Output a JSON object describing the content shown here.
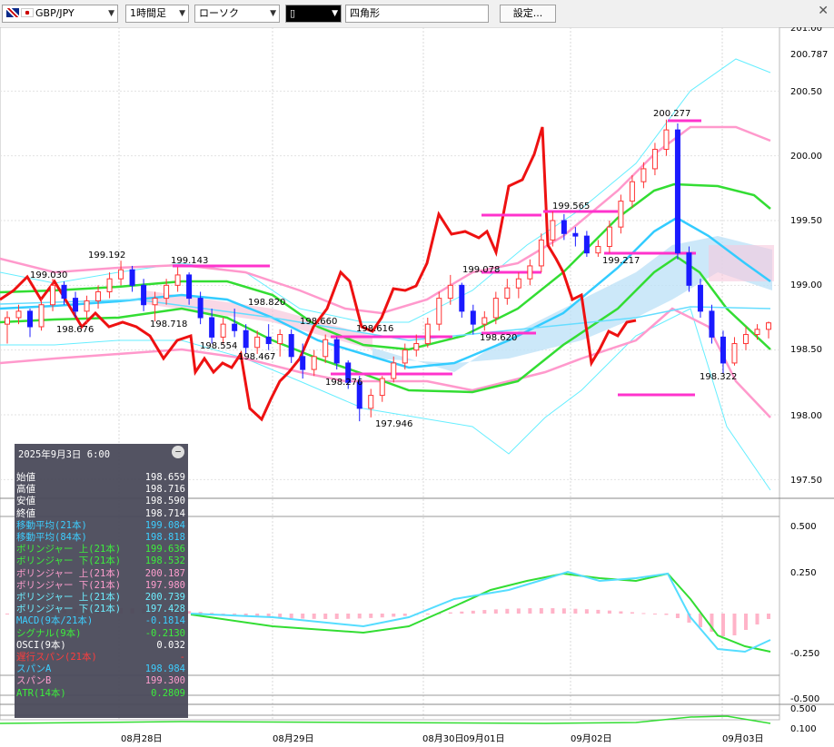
{
  "toolbar": {
    "symbol": "GBP/JPY",
    "timeframe": "1時間足",
    "chart_type": "ローソク",
    "draw_tool": "四角形",
    "settings_label": "設定...",
    "close_icon": "close-icon"
  },
  "chart_data": {
    "type": "candlestick",
    "y_axis": {
      "min": 197.9,
      "max": 201.0,
      "ticks": [
        "201.00",
        "200.787",
        "200.50",
        "200.00",
        "199.50",
        "199.00",
        "198.50",
        "198.00",
        "197.50"
      ]
    },
    "x_labels": [
      "08月28日",
      "08月29日",
      "08月30日",
      "09月01日",
      "09月02日",
      "09月03日"
    ],
    "annotations": [
      "199.192",
      "199.030",
      "199.143",
      "198.676",
      "198.718",
      "198.820",
      "198.554",
      "198.467",
      "198.660",
      "198.616",
      "198.276",
      "197.946",
      "199.078",
      "198.620",
      "199.565",
      "199.217",
      "200.277",
      "198.322"
    ],
    "candles": [
      [
        198.7,
        198.8,
        198.55,
        198.75
      ],
      [
        198.75,
        198.85,
        198.7,
        198.8
      ],
      [
        198.8,
        198.82,
        198.6,
        198.68
      ],
      [
        198.68,
        198.9,
        198.65,
        198.85
      ],
      [
        198.85,
        199.05,
        198.8,
        199.0
      ],
      [
        199.0,
        199.03,
        198.85,
        198.9
      ],
      [
        198.9,
        198.95,
        198.75,
        198.8
      ],
      [
        198.8,
        198.92,
        198.7,
        198.88
      ],
      [
        198.88,
        199.0,
        198.82,
        198.95
      ],
      [
        198.95,
        199.1,
        198.9,
        199.05
      ],
      [
        199.05,
        199.19,
        199.0,
        199.12
      ],
      [
        199.12,
        199.15,
        198.95,
        199.0
      ],
      [
        199.0,
        199.05,
        198.8,
        198.85
      ],
      [
        198.85,
        198.95,
        198.72,
        198.9
      ],
      [
        198.9,
        199.05,
        198.85,
        199.0
      ],
      [
        199.0,
        199.14,
        198.95,
        199.08
      ],
      [
        199.08,
        199.1,
        198.85,
        198.9
      ],
      [
        198.9,
        198.95,
        198.7,
        198.75
      ],
      [
        198.75,
        198.82,
        198.55,
        198.6
      ],
      [
        198.6,
        198.75,
        198.55,
        198.7
      ],
      [
        198.7,
        198.82,
        198.6,
        198.65
      ],
      [
        198.65,
        198.7,
        198.47,
        198.52
      ],
      [
        198.52,
        198.65,
        198.47,
        198.6
      ],
      [
        198.6,
        198.7,
        198.5,
        198.55
      ],
      [
        198.55,
        198.66,
        198.45,
        198.62
      ],
      [
        198.62,
        198.66,
        198.4,
        198.45
      ],
      [
        198.45,
        198.55,
        198.28,
        198.35
      ],
      [
        198.35,
        198.5,
        198.3,
        198.45
      ],
      [
        198.45,
        198.62,
        198.4,
        198.58
      ],
      [
        198.58,
        198.6,
        198.35,
        198.4
      ],
      [
        198.4,
        198.42,
        198.2,
        198.25
      ],
      [
        198.25,
        198.3,
        197.95,
        198.05
      ],
      [
        198.05,
        198.2,
        197.98,
        198.15
      ],
      [
        198.15,
        198.3,
        198.1,
        198.28
      ],
      [
        198.28,
        198.45,
        198.25,
        198.4
      ],
      [
        198.4,
        198.55,
        198.35,
        198.5
      ],
      [
        198.5,
        198.62,
        198.45,
        198.55
      ],
      [
        198.55,
        198.75,
        198.52,
        198.7
      ],
      [
        198.7,
        198.95,
        198.65,
        198.9
      ],
      [
        198.9,
        199.08,
        198.85,
        199.0
      ],
      [
        199.0,
        199.02,
        198.75,
        198.8
      ],
      [
        198.8,
        198.85,
        198.62,
        198.7
      ],
      [
        198.7,
        198.8,
        198.65,
        198.75
      ],
      [
        198.75,
        198.95,
        198.7,
        198.9
      ],
      [
        198.9,
        199.05,
        198.85,
        198.98
      ],
      [
        198.98,
        199.1,
        198.9,
        199.05
      ],
      [
        199.05,
        199.2,
        199.0,
        199.15
      ],
      [
        199.15,
        199.4,
        199.1,
        199.35
      ],
      [
        199.35,
        199.57,
        199.3,
        199.5
      ],
      [
        199.5,
        199.55,
        199.35,
        199.4
      ],
      [
        199.4,
        199.45,
        199.3,
        199.38
      ],
      [
        199.38,
        199.42,
        199.22,
        199.25
      ],
      [
        199.25,
        199.35,
        199.22,
        199.3
      ],
      [
        199.3,
        199.5,
        199.25,
        199.45
      ],
      [
        199.45,
        199.7,
        199.4,
        199.65
      ],
      [
        199.65,
        199.85,
        199.6,
        199.8
      ],
      [
        199.8,
        199.95,
        199.75,
        199.9
      ],
      [
        199.9,
        200.1,
        199.85,
        200.05
      ],
      [
        200.05,
        200.28,
        200.0,
        200.2
      ],
      [
        200.2,
        200.25,
        199.2,
        199.25
      ],
      [
        199.25,
        199.3,
        198.95,
        199.0
      ],
      [
        199.0,
        199.05,
        198.75,
        198.8
      ],
      [
        198.8,
        198.85,
        198.55,
        198.6
      ],
      [
        198.6,
        198.65,
        198.32,
        198.4
      ],
      [
        198.4,
        198.6,
        198.38,
        198.55
      ],
      [
        198.55,
        198.68,
        198.5,
        198.62
      ],
      [
        198.62,
        198.7,
        198.58,
        198.66
      ],
      [
        198.66,
        198.72,
        198.59,
        198.71
      ]
    ]
  },
  "info_panel": {
    "title": "2025年9月3日 6:00",
    "rows": [
      {
        "label": "始値",
        "value": "198.659",
        "color": "#ffffff"
      },
      {
        "label": "高値",
        "value": "198.716",
        "color": "#ffffff"
      },
      {
        "label": "安値",
        "value": "198.590",
        "color": "#ffffff"
      },
      {
        "label": "終値",
        "value": "198.714",
        "color": "#ffffff"
      },
      {
        "label": "移動平均(21本)",
        "value": "199.084",
        "color": "#33ccff"
      },
      {
        "label": "移動平均(84本)",
        "value": "198.818",
        "color": "#33ccff"
      },
      {
        "label": "ボリンジャー 上(21本)",
        "value": "199.636",
        "color": "#33ee33"
      },
      {
        "label": "ボリンジャー 下(21本)",
        "value": "198.532",
        "color": "#33ee33"
      },
      {
        "label": "ボリンジャー 上(21本)",
        "value": "200.187",
        "color": "#ff99cc"
      },
      {
        "label": "ボリンジャー 下(21本)",
        "value": "197.980",
        "color": "#ff99cc"
      },
      {
        "label": "ボリンジャー 上(21本)",
        "value": "200.739",
        "color": "#66eeff"
      },
      {
        "label": "ボリンジャー 下(21本)",
        "value": "197.428",
        "color": "#66eeff"
      },
      {
        "label": "MACD(9本/21本)",
        "value": "-0.1814",
        "color": "#33ccff"
      },
      {
        "label": "シグナル(9本)",
        "value": "-0.2130",
        "color": "#33ee33"
      },
      {
        "label": "OSCI(9本)",
        "value": "0.032",
        "color": "#ffffff"
      },
      {
        "label": "遅行スパン(21本)",
        "value": "-",
        "color": "#ff3333"
      },
      {
        "label": "スパンA",
        "value": "198.984",
        "color": "#33ccff"
      },
      {
        "label": "スパンB",
        "value": "199.300",
        "color": "#ff99cc"
      },
      {
        "label": "ATR(14本)",
        "value": "0.2809",
        "color": "#33ee33"
      }
    ]
  },
  "sub_axis": {
    "macd_ticks": [
      "0.500",
      "0.250",
      "-0.250",
      "-0.500"
    ],
    "atr_ticks": [
      "0.500",
      "0.100"
    ]
  },
  "colors": {
    "up": "#ff3333",
    "down": "#1a1aff",
    "ma21": "#33ccff",
    "ma84": "#66ddff",
    "bb1": "#33dd33",
    "bb2": "#ff99cc",
    "bb3": "#66eeff",
    "lag": "#ee1111",
    "box": "#ff33cc"
  }
}
